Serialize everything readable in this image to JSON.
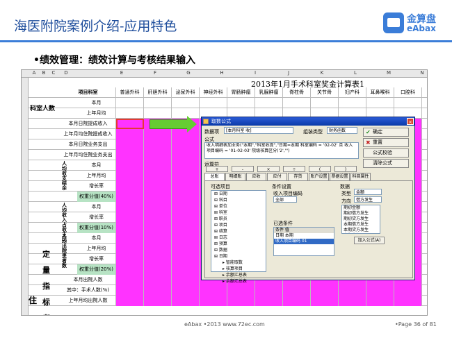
{
  "slide": {
    "title": "海医附院案例介绍-应用特色",
    "bullet": "•绩效管理：绩效计算与考核结果输入",
    "logo_cn": "金算盘",
    "logo_en": "eAbax",
    "footer": "eAbax •2013 www.72ec.com",
    "page": "•Page 36 of 81"
  },
  "sheet": {
    "title": "2013年1月手术科室奖金计算表1",
    "col_letters": [
      "A",
      "B",
      "C",
      "D",
      "E",
      "F",
      "G",
      "H",
      "I",
      "J",
      "K",
      "L",
      "M",
      "N",
      "O"
    ],
    "header_left": "项目科室",
    "departments": [
      "普通外科",
      "肝胆外科",
      "泌尿外科",
      "神经外科",
      "胃肠肿瘤",
      "乳腺肿瘤",
      "脊柱骨",
      "关节骨",
      "妇产科",
      "耳鼻喉科",
      "口腔科"
    ],
    "section_staff": "科室人数",
    "rows_staff": [
      "本月",
      "上年月均"
    ],
    "rows_income": [
      "本月日院提成收入",
      "上年月均住院提成收入",
      "本月日院业务支出",
      "上年月均住院业务支出"
    ],
    "group1_label": "人均收支结余",
    "group1_rows": [
      "本月",
      "上年月均",
      "增长率",
      "权重分值(40%)"
    ],
    "group2_label": "人均收入占收支比",
    "group2_rows": [
      "本月",
      "增长率",
      "权重分值(10%)"
    ],
    "group3_label": "人均出院患者数",
    "group3_rows": [
      "本月",
      "上年月均",
      "增长率",
      "权重分值(20%)"
    ],
    "bottom_rows": [
      "本月出院人数",
      "其中：手术人数(%)",
      "上年月均出院人数"
    ],
    "side_chars": [
      "定",
      "量",
      "指",
      "标",
      "考"
    ],
    "side_far": "住"
  },
  "dialog": {
    "title": "取数公式",
    "name_label": "数据项",
    "name_value": "[本月科室 收]",
    "type_label": "组装类型",
    "type_value": "财务函数",
    "formula_label": "公式",
    "formula_value": "收入明细表加业务(\"本期\",\"科室收提\",\"日期=本期 科室编码 = '02-02' 且 收入项目编码 = '01-02-03' 院级核算区分('2','\")",
    "ops_label": "运算符",
    "ops": [
      "+",
      "-",
      "×",
      "÷",
      "(",
      ")"
    ],
    "buttons": [
      "确定",
      "重置",
      "公式校验",
      "清除公式"
    ],
    "tabs": [
      "总账",
      "明细账",
      "应收",
      "应付",
      "存货",
      "账户设置",
      "票据设置",
      "科目属性"
    ],
    "tree_title": "可选项目",
    "tree_items": [
      "日期",
      "科目",
      "单位",
      "科室",
      "职员",
      "项目",
      "结算",
      "日志",
      "预算",
      "数据",
      "日期"
    ],
    "tree_sub": [
      "智能取数",
      "核算项目",
      "余额汇总表",
      "余额汇总表"
    ],
    "cond_label": "条件设置",
    "cond_name": "收入项目编码",
    "cond_value": "全部",
    "selected_label": "已选条件",
    "sel_headers": [
      "条件",
      "值"
    ],
    "sel_rows": [
      [
        "日期",
        "本期"
      ],
      [
        "收入项目编码",
        "01"
      ]
    ],
    "data_label": "数据",
    "data_type_label": "类型",
    "data_type": "金额",
    "data_src_label": "方向",
    "data_src": "借方发生",
    "data_items": [
      "期初金额",
      "期初借方发生",
      "期初贷方发生",
      "本期借方发生",
      "本期贷方发生",
      "本期余额",
      "本年借方发生",
      "本年贷方发生",
      "借方余额"
    ],
    "add_btn": "加入公式(A)"
  },
  "colors": {
    "accent": "#3b7dd8",
    "pink": "#ff33ff",
    "green": "#b7e3c4",
    "arrow": "#66cc33"
  }
}
